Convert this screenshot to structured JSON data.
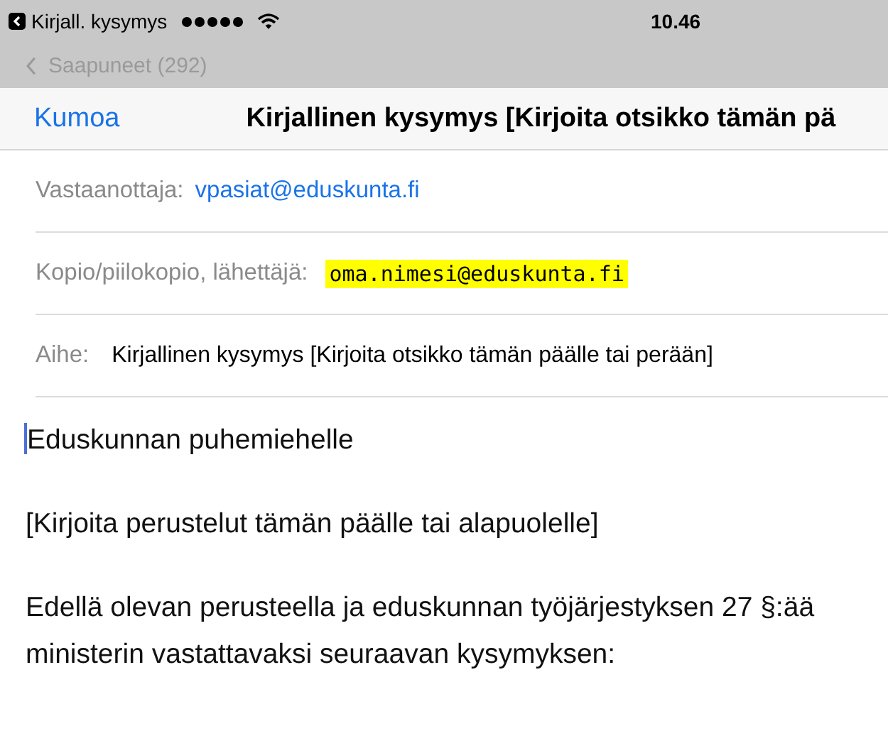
{
  "status_bar": {
    "back_app": "Kirjall. kysymys",
    "time": "10.46"
  },
  "background_nav": {
    "back_label": "Saapuneet (292)"
  },
  "nav": {
    "cancel": "Kumoa",
    "title": "Kirjallinen kysymys [Kirjoita otsikko tämän pä"
  },
  "fields": [
    {
      "label": "Vastaanottaja:",
      "value": "vpasiat@eduskunta.fi",
      "kind": "recipient"
    },
    {
      "label": "Kopio/piilokopio, lähettäjä:",
      "value": "oma.nimesi@eduskunta.fi",
      "kind": "highlighted"
    },
    {
      "label": "Aihe:",
      "value": "Kirjallinen kysymys [Kirjoita otsikko tämän päälle tai perään]",
      "kind": "subject"
    }
  ],
  "body": {
    "paragraphs": [
      "Eduskunnan puhemiehelle",
      "[Kirjoita perustelut tämän päälle tai alapuolelle]",
      "Edellä olevan perusteella ja eduskunnan työjärjestyksen 27 §:ää\nministerin vastattavaksi seuraavan kysymyksen:"
    ]
  }
}
